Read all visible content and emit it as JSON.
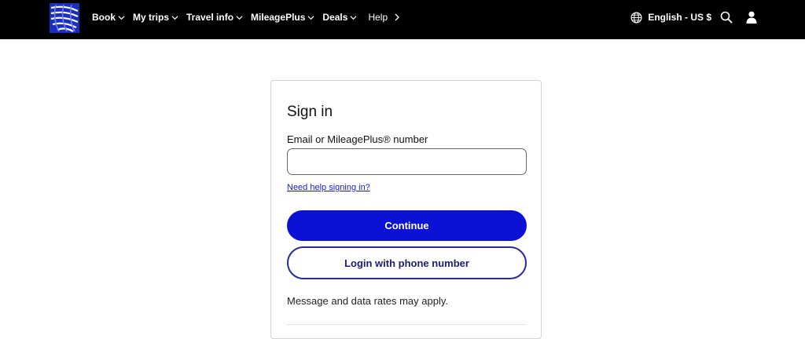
{
  "colors": {
    "nav_bg": "#000000",
    "brand_blue": "#0c11d6",
    "link_blue": "#1a1ad8",
    "outline_navy": "#2a2a9a"
  },
  "header": {
    "logo_icon": "globe-logo-icon",
    "nav": [
      {
        "label": "Book",
        "icon": "chevron-down-icon"
      },
      {
        "label": "My trips",
        "icon": "chevron-down-icon"
      },
      {
        "label": "Travel info",
        "icon": "chevron-down-icon"
      },
      {
        "label": "MileagePlus",
        "icon": "chevron-down-icon"
      },
      {
        "label": "Deals",
        "icon": "chevron-down-icon"
      },
      {
        "label": "Help",
        "icon": "chevron-right-icon"
      }
    ],
    "language": "English - US $",
    "tools": [
      "globe-icon",
      "search-icon",
      "user-icon"
    ]
  },
  "signin": {
    "title": "Sign in",
    "email_label": "Email or MileagePlus® number",
    "email_value": "",
    "email_placeholder": "",
    "help_link": "Need help signing in?",
    "continue_label": "Continue",
    "phone_label": "Login with phone number",
    "disclaimer": "Message and data rates may apply."
  }
}
